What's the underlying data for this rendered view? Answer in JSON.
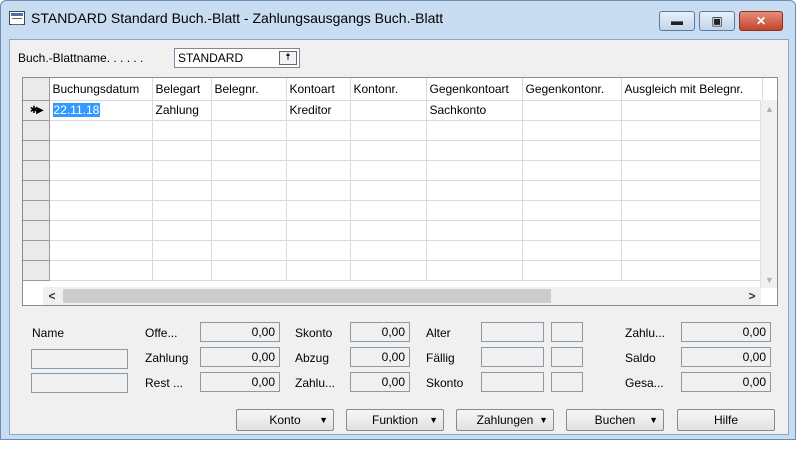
{
  "window": {
    "title": "STANDARD Standard Buch.-Blatt - Zahlungsausgangs Buch.-Blatt",
    "minimize_glyph": "▬",
    "maximize_glyph": "▣",
    "close_glyph": "✕"
  },
  "sheet": {
    "label": "Buch.-Blattname. . . . . .",
    "value": "STANDARD"
  },
  "grid": {
    "columns": [
      "Buchungsdatum",
      "Belegart",
      "Belegnr.",
      "Kontoart",
      "Kontonr.",
      "Gegenkontoart",
      "Gegenkontonr.",
      "Ausgleich mit Belegnr."
    ],
    "rows": [
      [
        "22.11.18",
        "Zahlung",
        "",
        "Kreditor",
        "",
        "Sachkonto",
        "",
        ""
      ]
    ],
    "empty_rows": 8,
    "row_marker": "✱▶"
  },
  "summary": {
    "name_label": "Name",
    "col2": [
      {
        "label": "Offe...",
        "value": "0,00"
      },
      {
        "label": "Zahlung",
        "value": "0,00"
      },
      {
        "label": "Rest ...",
        "value": "0,00"
      }
    ],
    "col3": [
      {
        "label": "Skonto",
        "value": "0,00"
      },
      {
        "label": "Abzug",
        "value": "0,00"
      },
      {
        "label": "Zahlu...",
        "value": "0,00"
      }
    ],
    "col4": [
      {
        "label": "Alter"
      },
      {
        "label": "Fällig"
      },
      {
        "label": "Skonto"
      }
    ],
    "col5": [
      {
        "label": "Zahlu...",
        "value": "0,00"
      },
      {
        "label": "Saldo",
        "value": "0,00"
      },
      {
        "label": "Gesa...",
        "value": "0,00"
      }
    ]
  },
  "buttons": {
    "konto": "Konto",
    "funktion": "Funktion",
    "zahlungen": "Zahlungen",
    "buchen": "Buchen",
    "hilfe": "Hilfe",
    "caret": "▼"
  }
}
